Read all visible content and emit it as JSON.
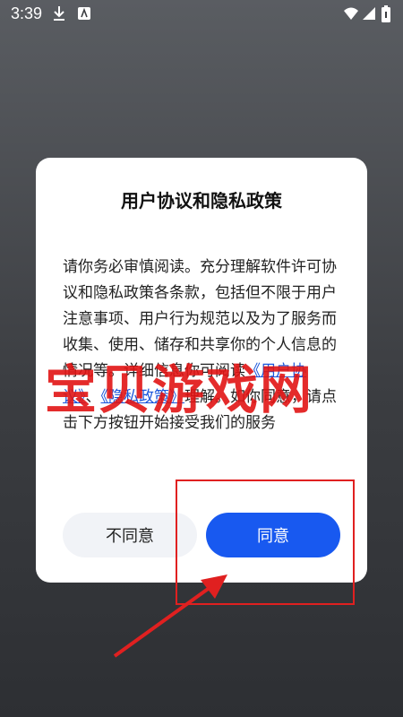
{
  "status_bar": {
    "time": "3:39",
    "icons": [
      "download-icon",
      "keyboard-icon",
      "wifi-icon",
      "signal-icon",
      "battery-icon"
    ]
  },
  "dialog": {
    "title": "用户协议和隐私政策",
    "body": {
      "text_1": "请你务必审慎阅读。充分理解软件许可协议和隐私政策各条款，包括但不限于用户注意事项、用户行为规范以及为了服务而收集、使用、储存和共享你的个人信息的情况等。详细信息你可阅读",
      "link_user_agreement": "《用户协议》",
      "separator": "、",
      "link_privacy_policy": "《隐私政策》",
      "text_2": "理解。如你同意，请点击下方按钮开始接受我们的服务"
    },
    "decline_label": "不同意",
    "agree_label": "同意"
  },
  "overlay": {
    "watermark_text": "宝贝游戏网",
    "accent_color": "#e02020"
  },
  "colors": {
    "primary_button": "#1859f0",
    "secondary_button": "#f1f3f7",
    "link": "#1a56db"
  }
}
